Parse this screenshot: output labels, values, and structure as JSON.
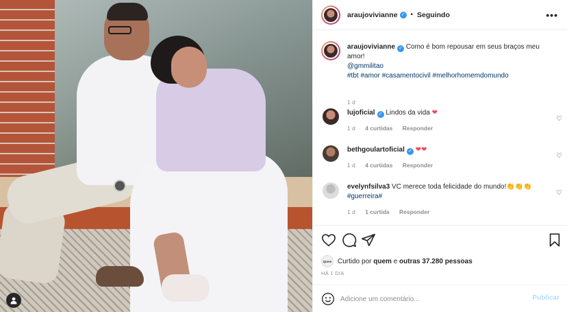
{
  "post": {
    "username": "araujovivianne",
    "follow_status": "Seguindo",
    "more_label": "•••",
    "caption": {
      "text": "Como é bom repousar em seus braços meu amor!",
      "mention": "@gmmilitao",
      "hashtags": "#tbt #amor #casamentocivil #melhorhomemdomundo",
      "time": "1 d"
    }
  },
  "comments": [
    {
      "username": "lujoficial",
      "text": "Lindos da vida",
      "emoji": "❤",
      "time": "1 d",
      "likes": "4 curtidas",
      "reply": "Responder"
    },
    {
      "username": "bethgoulartoficial",
      "text": "",
      "emoji": "❤❤",
      "time": "1 d",
      "likes": "4 curtidas",
      "reply": "Responder"
    },
    {
      "username": "evelynfsilva3",
      "text": "VC merece toda felicidade do mundo!",
      "emoji": "👏👏👏",
      "text2": "#guerreira#",
      "time": "1 d",
      "likes": "1 curtida",
      "reply": "Responder"
    }
  ],
  "likes": {
    "avatar_label": "Quem",
    "prefix": "Curtido por",
    "first": "quem",
    "connector": "e",
    "others": "outras 37.280 pessoas"
  },
  "timestamp": "HÁ 1 DIA",
  "add_comment": {
    "placeholder": "Adicione um comentário...",
    "publish": "Publicar"
  },
  "colors": {
    "link": "#00376b",
    "verified": "#3897f0",
    "heart_red": "#ed4956",
    "publish_disabled": "#b2dffc"
  }
}
